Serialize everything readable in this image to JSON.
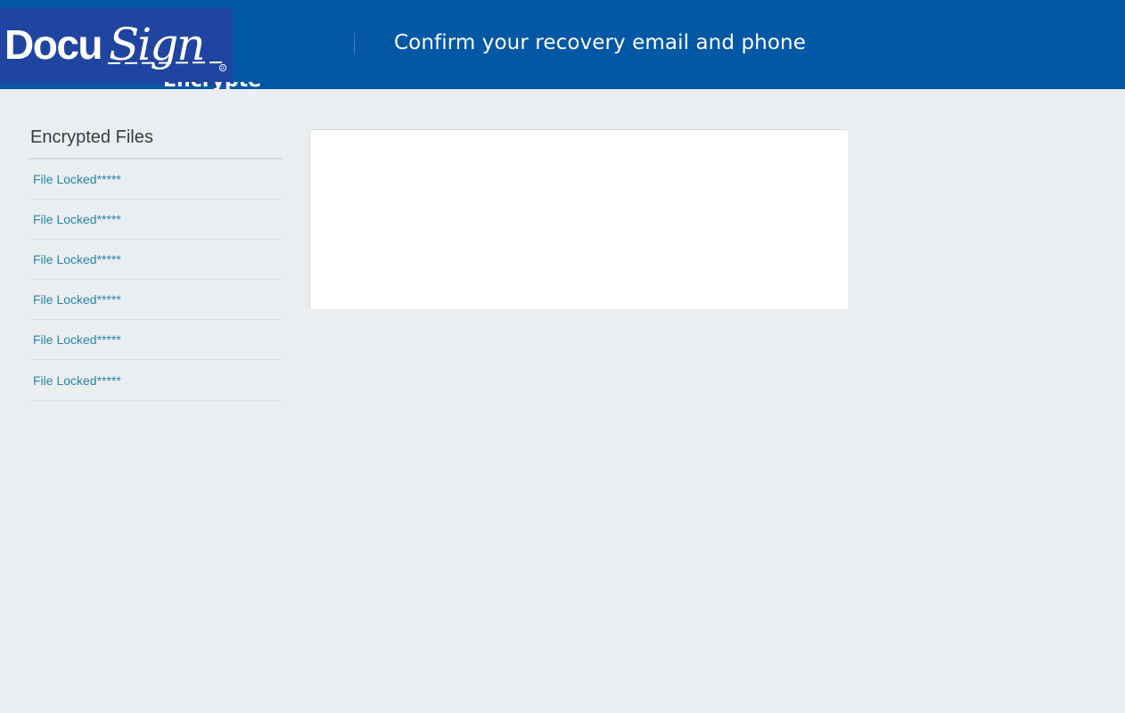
{
  "header": {
    "logo_text": "DocuSign",
    "title": "Confirm your recovery email and phone",
    "overflow_text": "Encrypted Files"
  },
  "sidebar": {
    "title": "Encrypted Files",
    "items": [
      {
        "label": "File Locked*****"
      },
      {
        "label": "File Locked*****"
      },
      {
        "label": "File Locked*****"
      },
      {
        "label": "File Locked*****"
      },
      {
        "label": "File Locked*****"
      },
      {
        "label": "File Locked*****"
      }
    ]
  },
  "colors": {
    "header_bg": "#0358a5",
    "logo_bg": "#1f45a0",
    "page_bg": "#eaeef0",
    "link": "#2a86a8",
    "panel_bg": "#ffffff"
  }
}
